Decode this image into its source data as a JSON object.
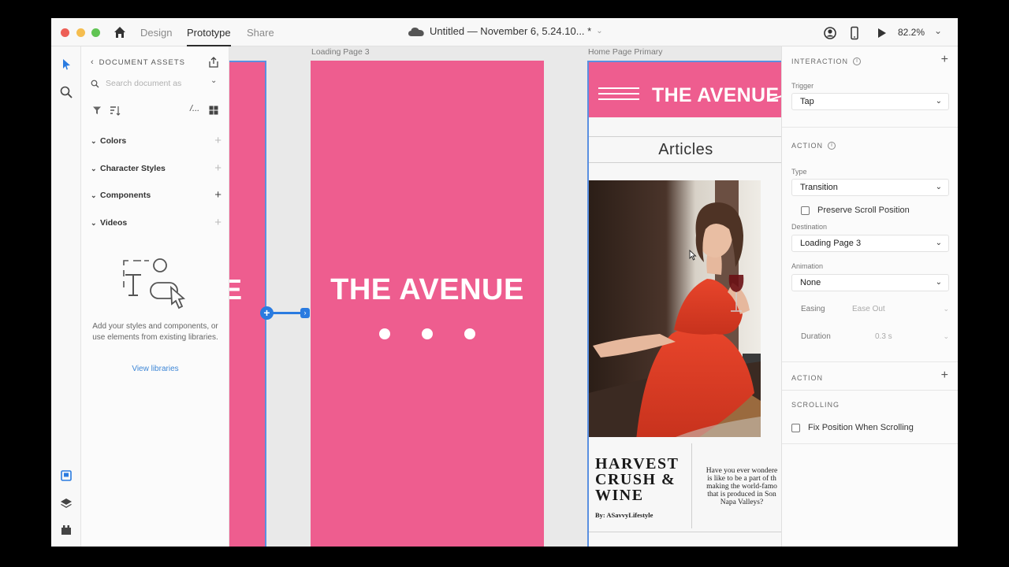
{
  "titlebar": {
    "tabs": [
      "Design",
      "Prototype",
      "Share"
    ],
    "active_tab": "Prototype",
    "doc_title": "Untitled — November 6, 5.24.10... *",
    "zoom": "82.2%"
  },
  "assets": {
    "header": "DOCUMENT ASSETS",
    "search_placeholder": "Search document as",
    "sections": [
      {
        "label": "Colors"
      },
      {
        "label": "Character Styles"
      },
      {
        "label": "Components"
      },
      {
        "label": "Videos"
      }
    ],
    "empty_text": "Add your styles and components, or use elements from existing libraries.",
    "view_libraries": "View libraries"
  },
  "canvas": {
    "artboards": {
      "loading_label": "Loading Page 3",
      "home_label": "Home Page Primary"
    },
    "brand": "THE AVENUE",
    "left_fragment": "E",
    "articles_heading": "Articles",
    "article_title": [
      "HARVEST",
      "CRUSH &",
      "WINE"
    ],
    "byline": "By: ASavvyLifestyle",
    "excerpt": "Have you ever wondered what it is like to be a part of the making the world-famous wine that is produced in Sonoma and Napa Valleys?",
    "excerpt_visible": [
      "Have you ever wondere",
      "is like to be a part of th",
      "making the world-famo",
      "that is produced in Son",
      "Napa Valleys?"
    ]
  },
  "inspector": {
    "interaction_label": "INTERACTION",
    "trigger_label": "Trigger",
    "trigger_value": "Tap",
    "action_label": "ACTION",
    "type_label": "Type",
    "type_value": "Transition",
    "preserve_scroll": "Preserve Scroll Position",
    "destination_label": "Destination",
    "destination_value": "Loading Page 3",
    "animation_label": "Animation",
    "animation_value": "None",
    "easing_label": "Easing",
    "easing_value": "Ease Out",
    "duration_label": "Duration",
    "duration_value": "0.3 s",
    "action2_label": "ACTION",
    "scrolling_label": "SCROLLING",
    "fix_position": "Fix Position When Scrolling"
  },
  "colors": {
    "brand_pink": "#ee5d8f",
    "selection_blue": "#2a7be0",
    "link_blue": "#3d86d6"
  }
}
